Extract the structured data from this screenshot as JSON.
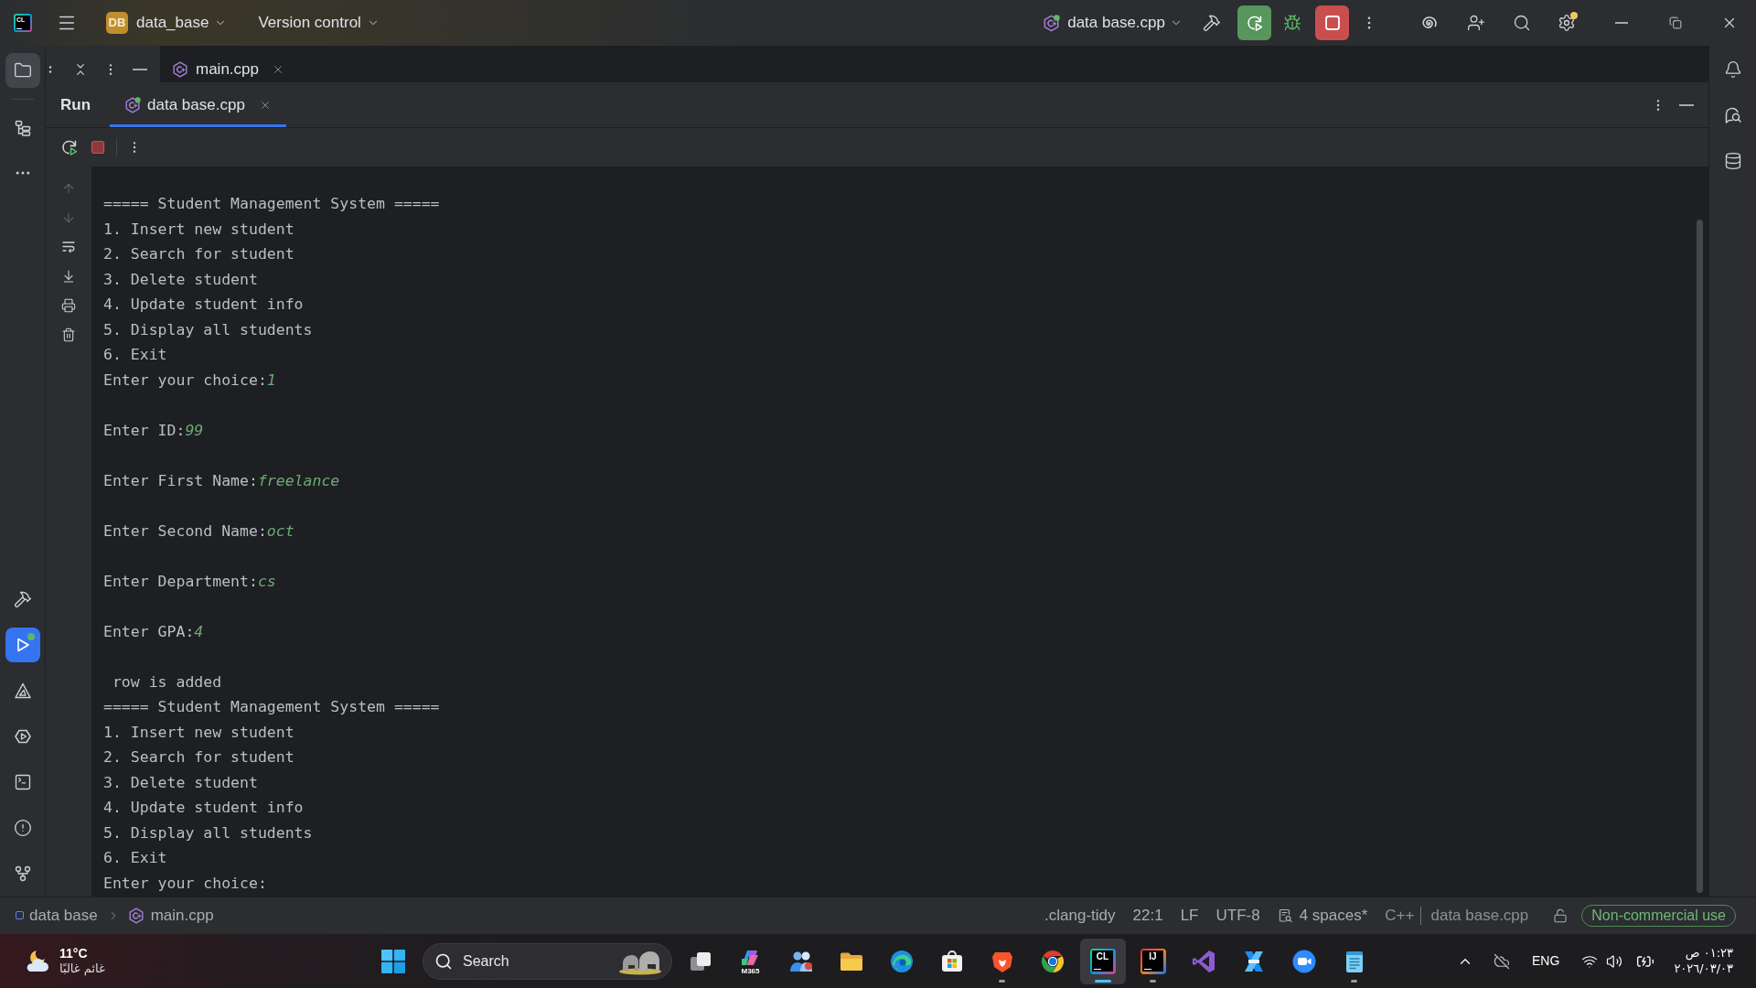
{
  "title_bar": {
    "app_logo": "CL",
    "project": {
      "badge": "DB",
      "name": "data_base"
    },
    "vcs_menu": "Version control",
    "run_config": {
      "name": "data base.cpp",
      "running": true
    }
  },
  "left_toolbar": {
    "top": [
      {
        "selected": true,
        "active": false
      },
      {
        "selected": false,
        "active": false
      }
    ],
    "bottom": [
      {
        "selected": false,
        "active": false,
        "running": false
      },
      {
        "selected": true,
        "active": true,
        "running": true
      },
      {
        "selected": false,
        "active": false,
        "running": false
      },
      {
        "selected": false,
        "active": false,
        "running": false
      },
      {
        "selected": false,
        "active": false,
        "running": false
      },
      {
        "selected": false,
        "active": false,
        "running": false
      },
      {
        "selected": false,
        "active": false,
        "running": false
      }
    ]
  },
  "editor_tabs": [
    {
      "label": "main.cpp",
      "selected": false
    }
  ],
  "run_panel": {
    "title": "Run",
    "tabs": [
      {
        "label": "data base.cpp",
        "selected": true,
        "running": true
      }
    ],
    "console": {
      "lines": [
        {
          "kind": "output",
          "text": "===== Student Management System ====="
        },
        {
          "kind": "output",
          "text": "1. Insert new student"
        },
        {
          "kind": "output",
          "text": "2. Search for student"
        },
        {
          "kind": "output",
          "text": "3. Delete student"
        },
        {
          "kind": "output",
          "text": "4. Update student info"
        },
        {
          "kind": "output",
          "text": "5. Display all students"
        },
        {
          "kind": "output",
          "text": "6. Exit"
        },
        {
          "kind": "prompt",
          "text": "Enter your choice:",
          "input": "1"
        },
        {
          "kind": "blank"
        },
        {
          "kind": "prompt",
          "text": "Enter ID:",
          "input": "99"
        },
        {
          "kind": "blank"
        },
        {
          "kind": "prompt",
          "text": "Enter First Name:",
          "input": "freelance"
        },
        {
          "kind": "blank"
        },
        {
          "kind": "prompt",
          "text": "Enter Second Name:",
          "input": "oct"
        },
        {
          "kind": "blank"
        },
        {
          "kind": "prompt",
          "text": "Enter Department:",
          "input": "cs"
        },
        {
          "kind": "blank"
        },
        {
          "kind": "prompt",
          "text": "Enter GPA:",
          "input": "4"
        },
        {
          "kind": "blank"
        },
        {
          "kind": "output",
          "text": " row is added"
        },
        {
          "kind": "output",
          "text": "===== Student Management System ====="
        },
        {
          "kind": "output",
          "text": "1. Insert new student"
        },
        {
          "kind": "output",
          "text": "2. Search for student"
        },
        {
          "kind": "output",
          "text": "3. Delete student"
        },
        {
          "kind": "output",
          "text": "4. Update student info"
        },
        {
          "kind": "output",
          "text": "5. Display all students"
        },
        {
          "kind": "output",
          "text": "6. Exit"
        },
        {
          "kind": "prompt",
          "text": "Enter your choice:"
        }
      ]
    }
  },
  "status_bar": {
    "breadcrumbs": [
      "data base",
      "main.cpp"
    ],
    "items": [
      {
        "kind": "text",
        "label": ".clang-tidy"
      },
      {
        "kind": "text",
        "label": "22:1"
      },
      {
        "kind": "text",
        "label": "LF"
      },
      {
        "kind": "text",
        "label": "UTF-8"
      },
      {
        "kind": "indent",
        "label": "4 spaces*"
      },
      {
        "kind": "text",
        "label": "C++"
      },
      {
        "kind": "context",
        "label": "data base.cpp"
      }
    ],
    "license": "Non-commercial use"
  },
  "taskbar": {
    "weather": {
      "temperature": "11°C",
      "condition": "غائم غالبًا"
    },
    "search": {
      "placeholder": "Search"
    },
    "apps": [
      {
        "running": false,
        "active": false
      },
      {
        "running": false,
        "active": false,
        "logo_text": "M365"
      },
      {
        "running": false,
        "active": false
      },
      {
        "running": false,
        "active": false
      },
      {
        "running": false,
        "active": false
      },
      {
        "running": false,
        "active": false
      },
      {
        "running": true,
        "active": false
      },
      {
        "running": false,
        "active": false
      },
      {
        "running": true,
        "active": true,
        "logo_text": "CL"
      },
      {
        "running": true,
        "active": false,
        "logo_text": "IJ"
      },
      {
        "running": false,
        "active": false
      },
      {
        "running": false,
        "active": false
      },
      {
        "running": false,
        "active": false
      },
      {
        "running": true,
        "active": false
      }
    ],
    "language": "ENG",
    "clock": {
      "time": "٠١:٢٣ ص",
      "date": "٢٠٢٦/٠٣/٠٣"
    }
  }
}
